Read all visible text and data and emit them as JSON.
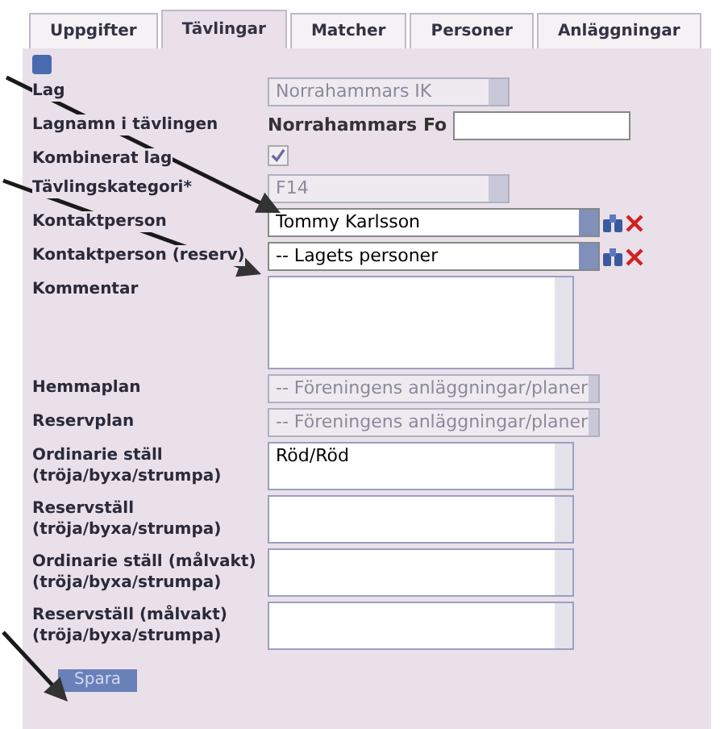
{
  "tabs": [
    {
      "label": "Uppgifter",
      "selected": false
    },
    {
      "label": "Tävlingar",
      "selected": true
    },
    {
      "label": "Matcher",
      "selected": false
    },
    {
      "label": "Personer",
      "selected": false
    },
    {
      "label": "Anläggningar",
      "selected": false
    }
  ],
  "fields": [
    {
      "kind": "select",
      "label": "Lag",
      "value": "Norrahammars IK",
      "disabled": true
    },
    {
      "kind": "prefixed",
      "label": "Lagnamn i tävlingen",
      "prefix": "Norrahammars Fo"
    },
    {
      "kind": "checkbox",
      "label": "Kombinerat lag",
      "checked": true,
      "disabled": true
    },
    {
      "kind": "select",
      "label": "Tävlingskategori*",
      "value": "F14",
      "disabled": true
    },
    {
      "kind": "person",
      "label": "Kontaktperson",
      "value": "Tommy Karlsson"
    },
    {
      "kind": "person",
      "label": "Kontaktperson (reserv)",
      "value": "-- Lagets personer"
    },
    {
      "kind": "comment",
      "label": "Kommentar"
    },
    {
      "kind": "select",
      "label": "Hemmaplan",
      "value": "-- Föreningens anläggningar/planer",
      "disabled": true
    },
    {
      "kind": "select",
      "label": "Reservplan",
      "value": "-- Föreningens anläggningar/planer",
      "disabled": true
    },
    {
      "kind": "textarea",
      "label": "Ordinarie ställ (tröja/byxa/strumpa)",
      "value": "Röd/Röd"
    },
    {
      "kind": "textarea",
      "label": "Reservställ (tröja/byxa/strumpa)"
    },
    {
      "kind": "textarea",
      "label": "Ordinarie ställ (målvakt) (tröja/byxa/strumpa)"
    },
    {
      "kind": "textarea",
      "label": "Reservställ (målvakt) (tröja/byxa/strumpa)"
    }
  ],
  "save_button": "Spara"
}
